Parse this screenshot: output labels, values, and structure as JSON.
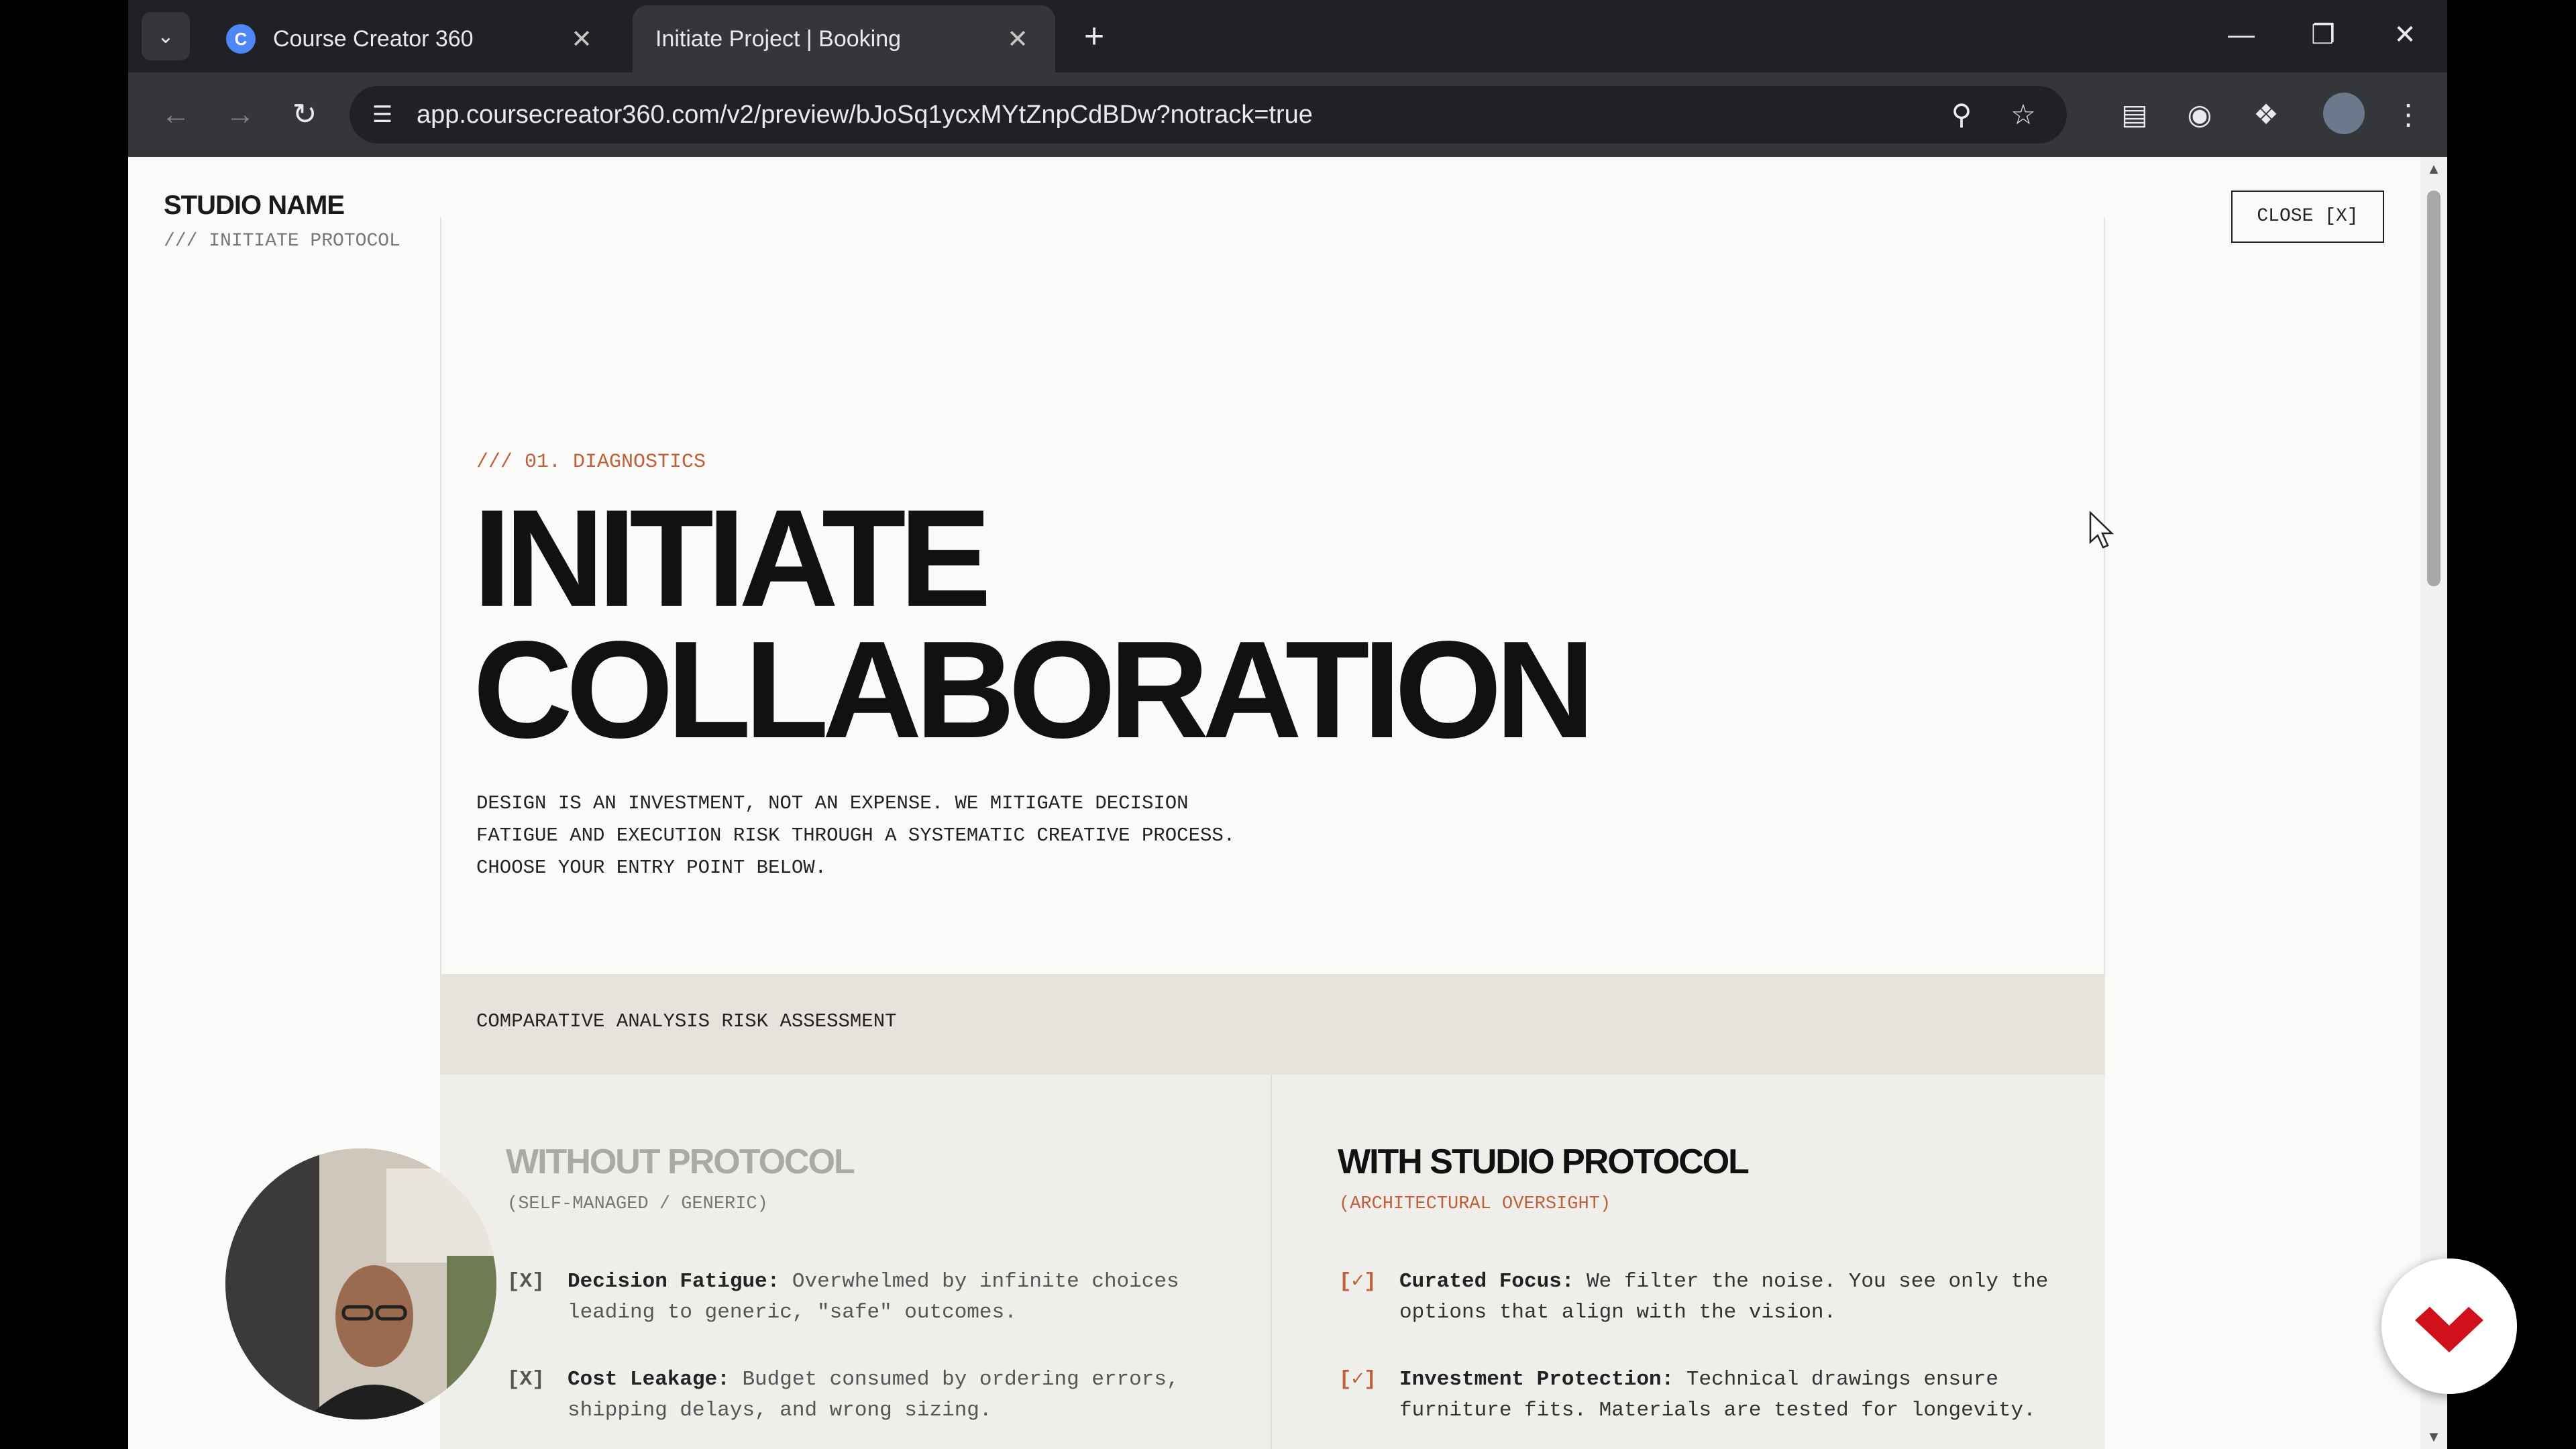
{
  "browser": {
    "tabs": [
      {
        "title": "Course Creator 360",
        "favicon_letter": "C",
        "active": false
      },
      {
        "title": "Initiate Project | Booking",
        "active": true
      }
    ],
    "url": "app.coursecreator360.com/v2/preview/bJoSq1ycxMYtZnpCdBDw?notrack=true"
  },
  "page": {
    "studio_name": "STUDIO NAME",
    "studio_sub": "/// INITIATE PROTOCOL",
    "close_label": "CLOSE [X]",
    "eyebrow": "/// 01. DIAGNOSTICS",
    "hero_line1": "INITIATE",
    "hero_line2": "COLLABORATION",
    "lede": "DESIGN IS AN INVESTMENT, NOT AN EXPENSE. WE MITIGATE DECISION FATIGUE AND EXECUTION RISK THROUGH A SYSTEMATIC CREATIVE PROCESS. CHOOSE YOUR ENTRY POINT BELOW.",
    "panel_title": "COMPARATIVE ANALYSIS RISK ASSESSMENT",
    "without": {
      "title": "WITHOUT PROTOCOL",
      "tag": "(SELF-MANAGED / GENERIC)",
      "marker": "[X]",
      "items": [
        {
          "label": "Decision Fatigue:",
          "text": "Overwhelmed by infinite choices leading to generic, \"safe\" outcomes."
        },
        {
          "label": "Cost Leakage:",
          "text": "Budget consumed by ordering errors, shipping delays, and wrong sizing."
        }
      ]
    },
    "with": {
      "title": "WITH STUDIO PROTOCOL",
      "tag": "(ARCHITECTURAL OVERSIGHT)",
      "marker": "[✓]",
      "items": [
        {
          "label": "Curated Focus:",
          "text": "We filter the noise. You see only the options that align with the vision."
        },
        {
          "label": "Investment Protection:",
          "text": "Technical drawings ensure furniture fits. Materials are tested for longevity."
        }
      ]
    }
  },
  "colors": {
    "accent": "#c0603a",
    "panel": "#e6e3dd",
    "badge": "#d0101a"
  }
}
